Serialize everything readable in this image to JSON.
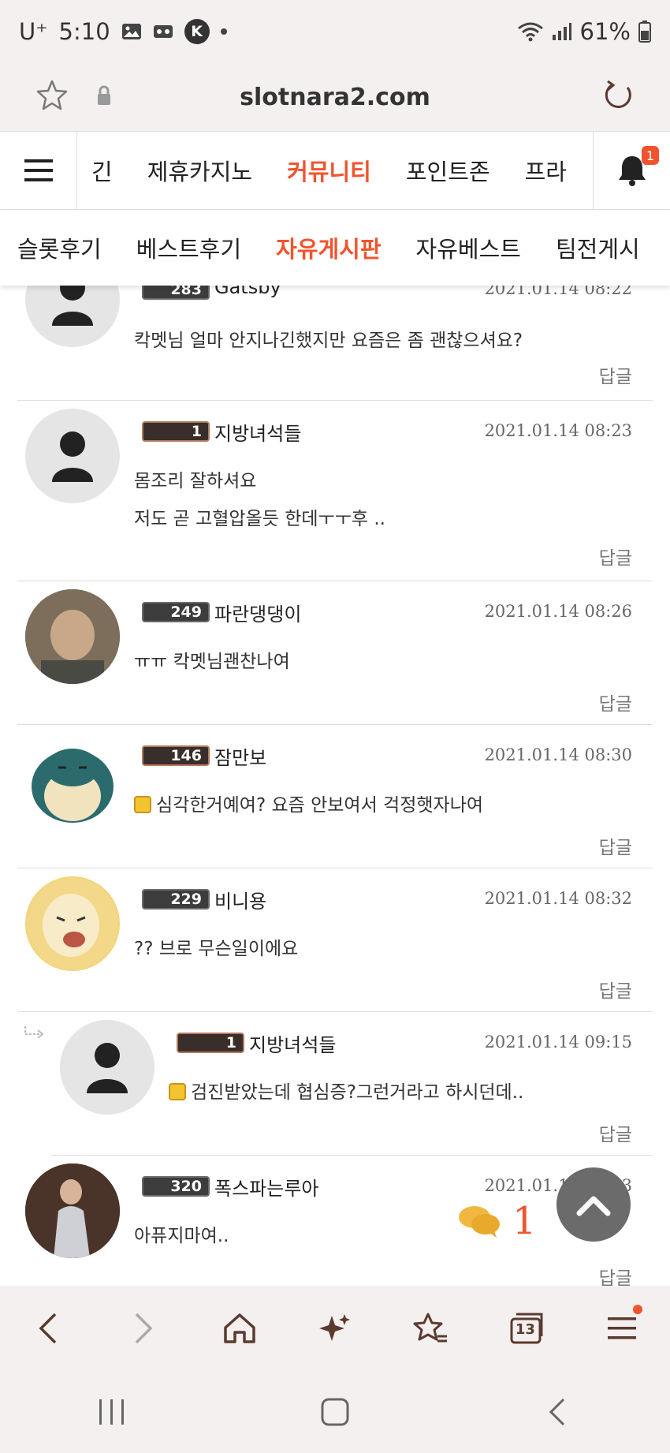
{
  "status_bar": {
    "carrier": "U⁺",
    "time": "5:10",
    "k_badge": "K",
    "battery": "61%"
  },
  "url_bar": {
    "url": "slotnara2.com"
  },
  "main_nav": {
    "items": [
      "긴",
      "제휴카지노",
      "커뮤니티",
      "포인트존",
      "프라"
    ],
    "active_index": 2,
    "notification_count": "1"
  },
  "sub_nav": {
    "items": [
      "슬롯후기",
      "베스트후기",
      "자유게시판",
      "자유베스트",
      "팀전게시"
    ],
    "active_index": 2
  },
  "comments": [
    {
      "level": "283",
      "nickname": "Gatsby",
      "date": "2021.01.14 08:22",
      "lines": [
        "칵멧님 얼마 안지나긴했지만 요즘은 좀 괜찮으셔요?"
      ],
      "reply": "답글"
    },
    {
      "level": "1",
      "nickname": "지방녀석들",
      "date": "2021.01.14 08:23",
      "lines": [
        "몸조리 잘하셔요",
        "저도 곧 고혈압올듯 한데ㅜㅜ후 .."
      ],
      "reply": "답글"
    },
    {
      "level": "249",
      "nickname": "파란댕댕이",
      "date": "2021.01.14 08:26",
      "lines": [
        "ㅠㅠ 칵멧님괜찬나여"
      ],
      "reply": "답글"
    },
    {
      "level": "146",
      "nickname": "잠만보",
      "date": "2021.01.14 08:30",
      "lines": [
        "심각한거예여? 요즘 안보여서 걱정햇자나여"
      ],
      "reply": "답글"
    },
    {
      "level": "229",
      "nickname": "비니용",
      "date": "2021.01.14 08:32",
      "lines": [
        "?? 브로 무슨일이에요"
      ],
      "reply": "답글"
    },
    {
      "level": "1",
      "nickname": "지방녀석들",
      "date": "2021.01.14 09:15",
      "lines": [
        "검진받았는데 협심증?그런거라고 하시던데.."
      ],
      "reply": "답글"
    },
    {
      "level": "320",
      "nickname": "폭스파는루아",
      "date": "2021.01.14 09:13",
      "lines": [
        "아퓨지마여.."
      ],
      "reply": "답글"
    }
  ],
  "floating": {
    "comment_count": "1"
  },
  "toolbar": {
    "tabs_count": "13"
  },
  "colors": {
    "accent": "#f0542e",
    "chrome_bg": "#f5f0f0"
  }
}
